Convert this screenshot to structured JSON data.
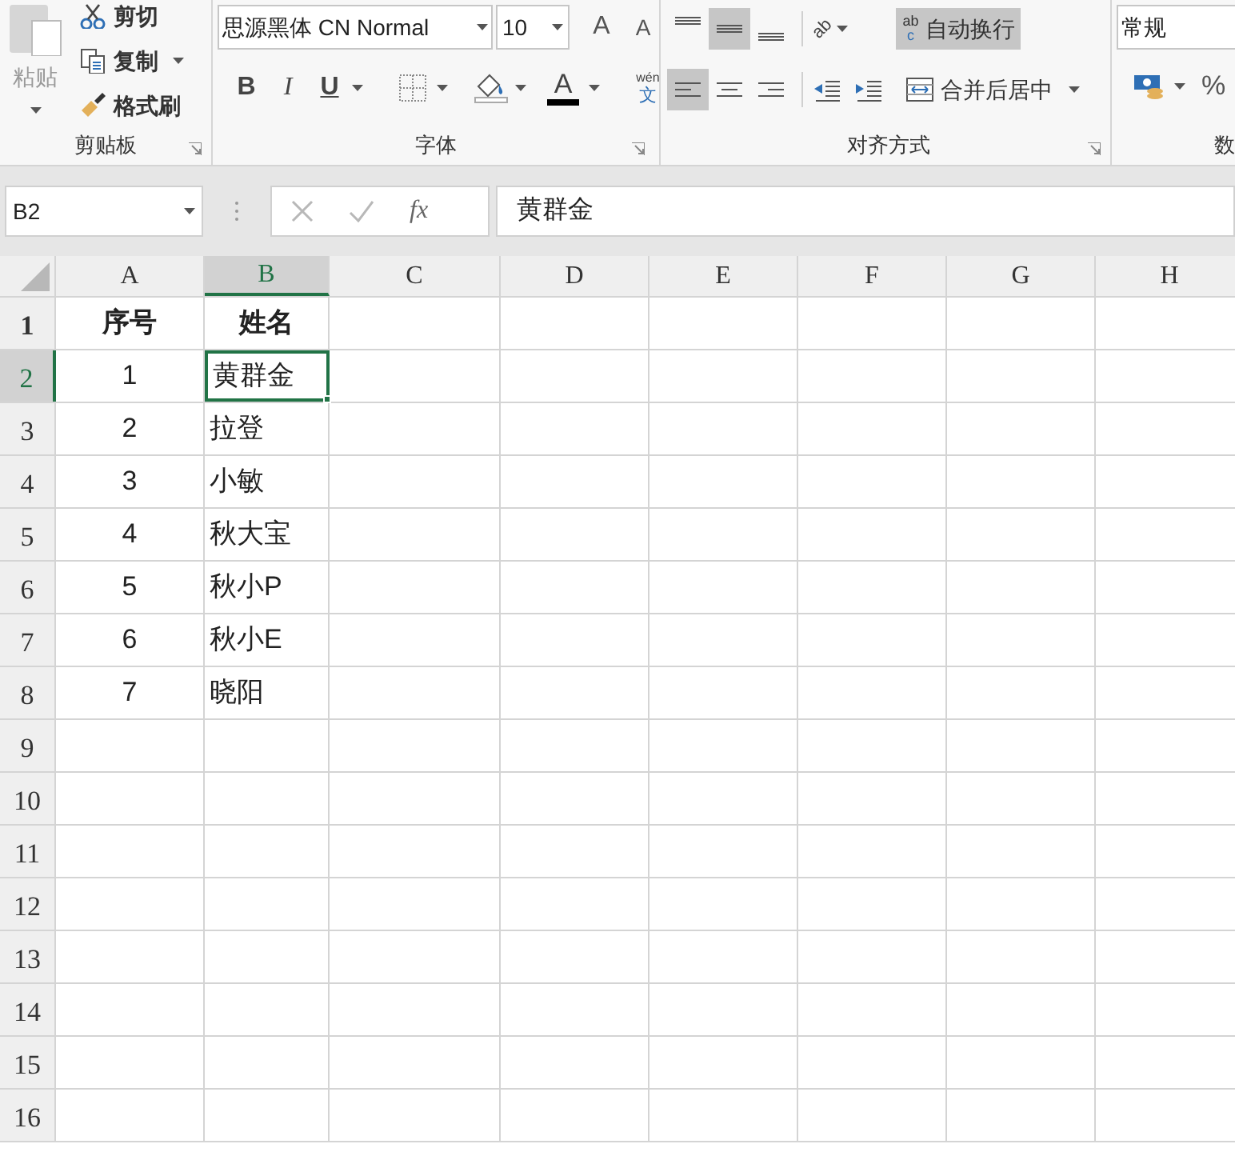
{
  "ribbon": {
    "groups": [
      {
        "kind": "clipboard",
        "label": "剪贴板",
        "paste": {
          "label": "粘贴",
          "disabled": true
        },
        "items": [
          {
            "label": "剪切",
            "dropdown": false
          },
          {
            "label": "复制",
            "dropdown": true
          },
          {
            "label": "格式刷",
            "dropdown": false
          }
        ]
      },
      {
        "kind": "font",
        "label": "字体",
        "font_name": "思源黑体 CN Normal",
        "font_size": "10",
        "grow": "A",
        "shrink": "A",
        "styles": [
          "B",
          "I",
          "U"
        ],
        "font_color": "A",
        "phonetic": {
          "ruby": "wén",
          "base": "文"
        }
      },
      {
        "kind": "alignment",
        "label": "对齐方式",
        "vertical": [
          {
            "selected": false
          },
          {
            "selected": true
          },
          {
            "selected": false
          }
        ],
        "orientation": "ab",
        "horizontal": [
          {
            "selected": true
          },
          {
            "selected": false
          },
          {
            "selected": false
          }
        ],
        "wrap": {
          "icon_top": "ab",
          "icon_bottom": "c",
          "label": "自动换行",
          "selected": true
        },
        "merge": {
          "label": "合并后居中"
        }
      },
      {
        "kind": "number",
        "label": "数",
        "format": "常规",
        "percent": "%"
      }
    ]
  },
  "formula_bar": {
    "name_box": "B2",
    "function_symbol": "fx",
    "value": "黄群金"
  },
  "sheet": {
    "columns": [
      {
        "label": "A",
        "selected": false
      },
      {
        "label": "B",
        "selected": true
      },
      {
        "label": "C",
        "selected": false
      },
      {
        "label": "D",
        "selected": false
      },
      {
        "label": "E",
        "selected": false
      },
      {
        "label": "F",
        "selected": false
      },
      {
        "label": "G",
        "selected": false
      },
      {
        "label": "H",
        "selected": false
      }
    ],
    "rows": [
      {
        "label": "1",
        "kind": "header",
        "selected": false,
        "cells": [
          {
            "text": "序号",
            "selected": false
          },
          {
            "text": "姓名",
            "selected": false
          }
        ]
      },
      {
        "label": "2",
        "selected": true,
        "cells": [
          {
            "text": "1",
            "selected": false
          },
          {
            "text": "黄群金",
            "selected": true
          }
        ]
      },
      {
        "label": "3",
        "selected": false,
        "cells": [
          {
            "text": "2",
            "selected": false
          },
          {
            "text": "拉登",
            "selected": false
          }
        ]
      },
      {
        "label": "4",
        "selected": false,
        "cells": [
          {
            "text": "3",
            "selected": false
          },
          {
            "text": "小敏",
            "selected": false
          }
        ]
      },
      {
        "label": "5",
        "selected": false,
        "cells": [
          {
            "text": "4",
            "selected": false
          },
          {
            "text": "秋大宝",
            "selected": false
          }
        ]
      },
      {
        "label": "6",
        "selected": false,
        "cells": [
          {
            "text": "5",
            "selected": false
          },
          {
            "text": "秋小P",
            "selected": false
          }
        ]
      },
      {
        "label": "7",
        "selected": false,
        "cells": [
          {
            "text": "6",
            "selected": false
          },
          {
            "text": "秋小E",
            "selected": false
          }
        ]
      },
      {
        "label": "8",
        "selected": false,
        "cells": [
          {
            "text": "7",
            "selected": false
          },
          {
            "text": "晓阳",
            "selected": false
          }
        ]
      },
      {
        "label": "9",
        "selected": false
      },
      {
        "label": "10",
        "selected": false
      },
      {
        "label": "11",
        "selected": false
      },
      {
        "label": "12",
        "selected": false
      },
      {
        "label": "13",
        "selected": false
      },
      {
        "label": "14",
        "selected": false
      },
      {
        "label": "15",
        "selected": false
      },
      {
        "label": "16",
        "selected": false
      }
    ]
  }
}
